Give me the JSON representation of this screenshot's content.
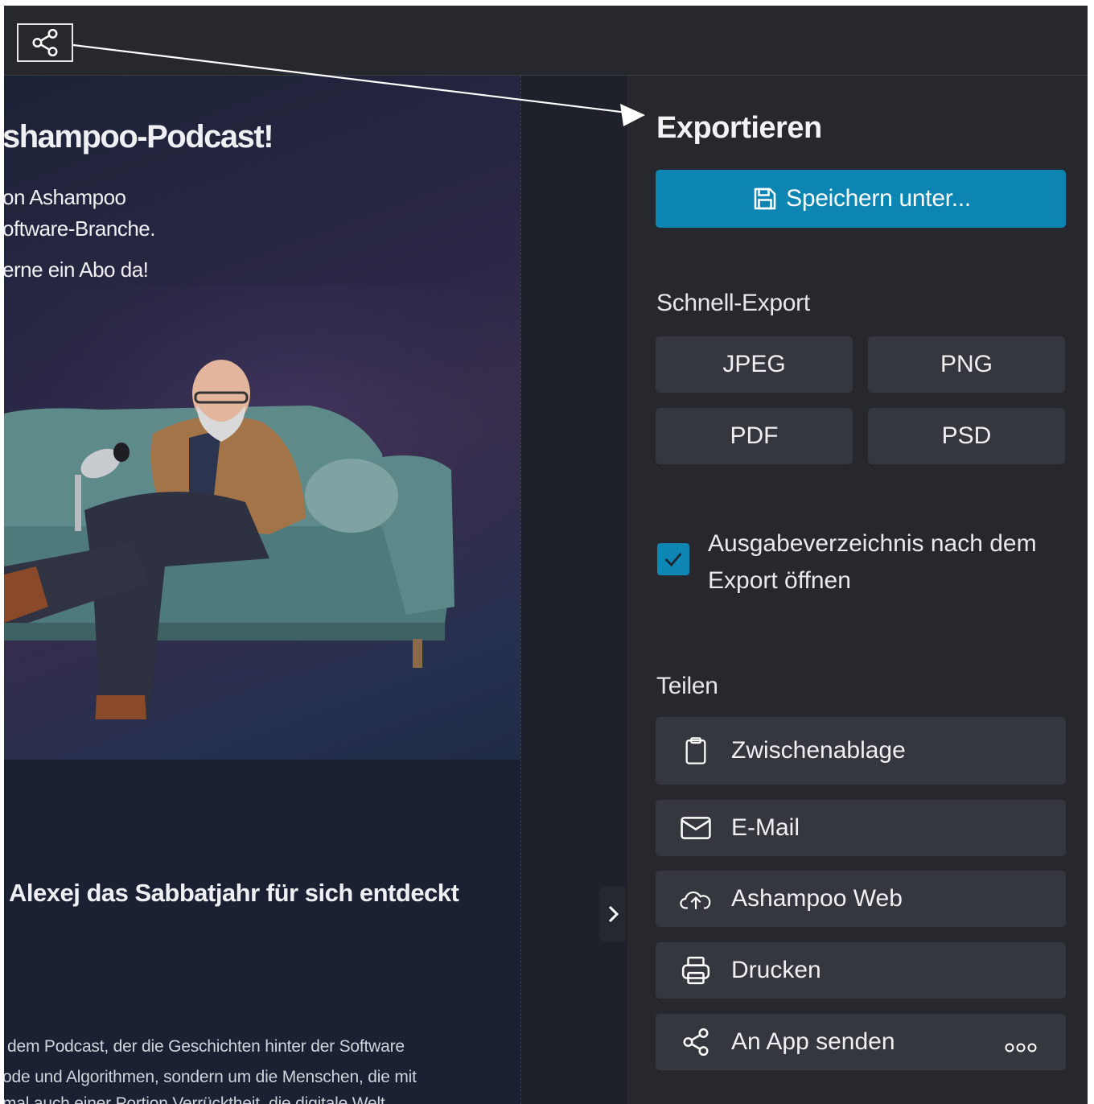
{
  "canvas": {
    "title": "shampoo-Podcast!",
    "intro_lines": [
      "on Ashampoo",
      "oftware-Branche.",
      "erne ein Abo da!"
    ],
    "heading": "Alexej das Sabbatjahr für sich entdeckt",
    "body_lines": [
      "dem Podcast, der die Geschichten hinter der Software",
      "ode und Algorithmen, sondern um die Menschen, die mit",
      "mal auch einer Portion Verrücktheit, die digitale Welt"
    ]
  },
  "panel": {
    "title": "Exportieren",
    "save_label": "Speichern unter...",
    "quick_export_label": "Schnell-Export",
    "formats": [
      "JPEG",
      "PNG",
      "PDF",
      "PSD"
    ],
    "open_folder_label": "Ausgabeverzeichnis nach dem Export öffnen",
    "open_folder_checked": true,
    "share_label": "Teilen",
    "share_items": [
      {
        "label": "Zwischenablage",
        "icon": "clipboard-icon"
      },
      {
        "label": "E-Mail",
        "icon": "mail-icon"
      },
      {
        "label": "Ashampoo Web",
        "icon": "cloud-upload-icon"
      },
      {
        "label": "Drucken",
        "icon": "printer-icon"
      },
      {
        "label": "An App senden",
        "icon": "share-icon"
      }
    ]
  },
  "colors": {
    "accent": "#0d85b3",
    "panel_bg": "#26282d",
    "button_bg": "#34373d"
  }
}
